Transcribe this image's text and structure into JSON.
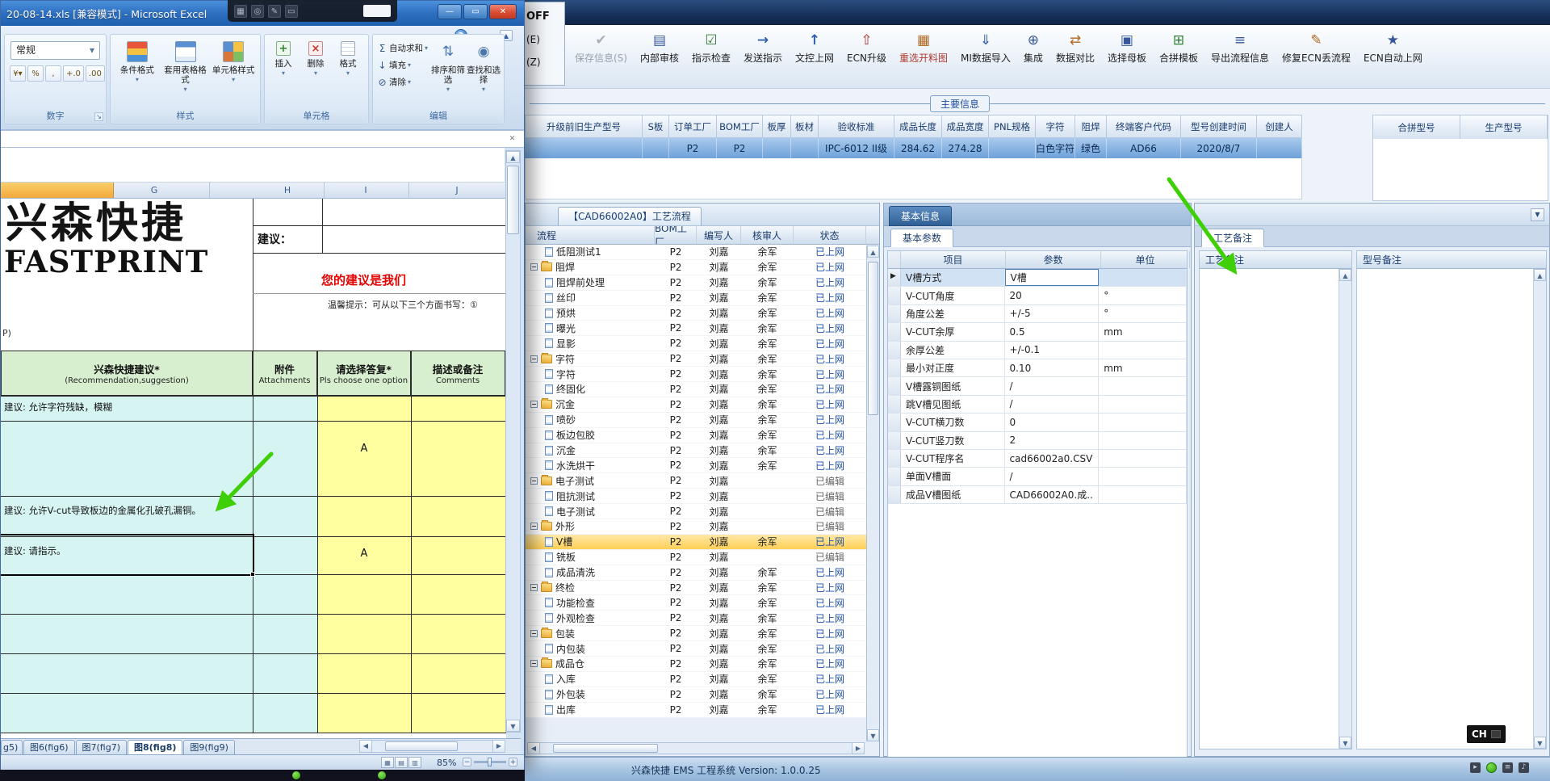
{
  "ems": {
    "partial_menu": [
      "OFF",
      "(E)",
      "(Z)"
    ],
    "toolbar": {
      "buttons": [
        {
          "label": "保存信息(S)",
          "icon": "save-icon",
          "glyph": "✔",
          "disabled": true
        },
        {
          "label": "内部审核",
          "icon": "internal-audit-icon",
          "glyph": "▤"
        },
        {
          "label": "指示检查",
          "icon": "instruction-check-icon",
          "glyph": "☑"
        },
        {
          "label": "发送指示",
          "icon": "send-instruction-icon",
          "glyph": "→"
        },
        {
          "label": "文控上网",
          "icon": "doc-upload-icon",
          "glyph": "↑"
        },
        {
          "label": "ECN升级",
          "icon": "ecn-upgrade-icon",
          "glyph": "⇧"
        },
        {
          "label": "重选开料图",
          "icon": "reselect-cutting-icon",
          "glyph": "▦",
          "accent": true
        },
        {
          "label": "MI数据导入",
          "icon": "mi-import-icon",
          "glyph": "⇓"
        },
        {
          "label": "集成",
          "icon": "integrate-icon",
          "glyph": "⊕"
        },
        {
          "label": "数据对比",
          "icon": "data-compare-icon",
          "glyph": "⇄"
        },
        {
          "label": "选择母板",
          "icon": "select-board-icon",
          "glyph": "▣"
        },
        {
          "label": "合拼模板",
          "icon": "merge-template-icon",
          "glyph": "⊞"
        },
        {
          "label": "导出流程信息",
          "icon": "export-flow-icon",
          "glyph": "≡"
        },
        {
          "label": "修复ECN丢流程",
          "icon": "repair-ecn-icon",
          "glyph": "✎"
        },
        {
          "label": "ECN自动上网",
          "icon": "ecn-auto-upload-icon",
          "glyph": "★"
        }
      ]
    },
    "main_info": {
      "legend": "主要信息",
      "columns": [
        "升级前旧生产型号",
        "S板",
        "订单工厂",
        "BOM工厂",
        "板厚",
        "板材",
        "验收标准",
        "成品长度",
        "成品宽度",
        "PNL规格",
        "字符",
        "阻焊",
        "终端客户代码",
        "型号创建时间",
        "创建人"
      ],
      "values": [
        "",
        "",
        "P2",
        "P2",
        "",
        "",
        "IPC-6012 II级",
        "284.62",
        "274.28",
        "",
        "白色字符",
        "绿色",
        "AD66",
        "2020/8/7",
        ""
      ],
      "right_columns": [
        "合拼型号",
        "生产型号"
      ]
    },
    "workflow": {
      "title": "【CAD66002A0】工艺流程",
      "columns": [
        "流程",
        "BOM工厂",
        "编写人",
        "核审人",
        "状态"
      ],
      "rows": [
        {
          "name": "低阻测试1",
          "level": 1,
          "type": "leaf",
          "bom": "P2",
          "writer": "刘嘉",
          "reviewer": "余军",
          "status": "已上网"
        },
        {
          "name": "阻焊",
          "level": 0,
          "type": "folder",
          "bom": "P2",
          "writer": "刘嘉",
          "reviewer": "余军",
          "status": "已上网"
        },
        {
          "name": "阻焊前处理",
          "level": 1,
          "type": "leaf",
          "bom": "P2",
          "writer": "刘嘉",
          "reviewer": "余军",
          "status": "已上网"
        },
        {
          "name": "丝印",
          "level": 1,
          "type": "leaf",
          "bom": "P2",
          "writer": "刘嘉",
          "reviewer": "余军",
          "status": "已上网"
        },
        {
          "name": "预烘",
          "level": 1,
          "type": "leaf",
          "bom": "P2",
          "writer": "刘嘉",
          "reviewer": "余军",
          "status": "已上网"
        },
        {
          "name": "曝光",
          "level": 1,
          "type": "leaf",
          "bom": "P2",
          "writer": "刘嘉",
          "reviewer": "余军",
          "status": "已上网"
        },
        {
          "name": "显影",
          "level": 1,
          "type": "leaf",
          "bom": "P2",
          "writer": "刘嘉",
          "reviewer": "余军",
          "status": "已上网"
        },
        {
          "name": "字符",
          "level": 0,
          "type": "folder",
          "bom": "P2",
          "writer": "刘嘉",
          "reviewer": "余军",
          "status": "已上网"
        },
        {
          "name": "字符",
          "level": 1,
          "type": "leaf",
          "bom": "P2",
          "writer": "刘嘉",
          "reviewer": "余军",
          "status": "已上网"
        },
        {
          "name": "终固化",
          "level": 1,
          "type": "leaf",
          "bom": "P2",
          "writer": "刘嘉",
          "reviewer": "余军",
          "status": "已上网"
        },
        {
          "name": "沉金",
          "level": 0,
          "type": "folder",
          "bom": "P2",
          "writer": "刘嘉",
          "reviewer": "余军",
          "status": "已上网"
        },
        {
          "name": "喷砂",
          "level": 1,
          "type": "leaf",
          "bom": "P2",
          "writer": "刘嘉",
          "reviewer": "余军",
          "status": "已上网"
        },
        {
          "name": "板边包胶",
          "level": 1,
          "type": "leaf",
          "bom": "P2",
          "writer": "刘嘉",
          "reviewer": "余军",
          "status": "已上网"
        },
        {
          "name": "沉金",
          "level": 1,
          "type": "leaf",
          "bom": "P2",
          "writer": "刘嘉",
          "reviewer": "余军",
          "status": "已上网"
        },
        {
          "name": "水洗烘干",
          "level": 1,
          "type": "leaf",
          "bom": "P2",
          "writer": "刘嘉",
          "reviewer": "余军",
          "status": "已上网"
        },
        {
          "name": "电子测试",
          "level": 0,
          "type": "folder",
          "bom": "P2",
          "writer": "刘嘉",
          "reviewer": "",
          "status": "已编辑"
        },
        {
          "name": "阻抗测试",
          "level": 1,
          "type": "leaf",
          "bom": "P2",
          "writer": "刘嘉",
          "reviewer": "",
          "status": "已编辑"
        },
        {
          "name": "电子测试",
          "level": 1,
          "type": "leaf",
          "bom": "P2",
          "writer": "刘嘉",
          "reviewer": "",
          "status": "已编辑"
        },
        {
          "name": "外形",
          "level": 0,
          "type": "folder",
          "bom": "P2",
          "writer": "刘嘉",
          "reviewer": "",
          "status": "已编辑"
        },
        {
          "name": "V槽",
          "level": 1,
          "type": "leaf",
          "bom": "P2",
          "writer": "刘嘉",
          "reviewer": "余军",
          "status": "已上网",
          "selected": true
        },
        {
          "name": "铣板",
          "level": 1,
          "type": "leaf",
          "bom": "P2",
          "writer": "刘嘉",
          "reviewer": "",
          "status": "已编辑"
        },
        {
          "name": "成品清洗",
          "level": 1,
          "type": "leaf",
          "bom": "P2",
          "writer": "刘嘉",
          "reviewer": "余军",
          "status": "已上网"
        },
        {
          "name": "终检",
          "level": 0,
          "type": "folder",
          "bom": "P2",
          "writer": "刘嘉",
          "reviewer": "余军",
          "status": "已上网"
        },
        {
          "name": "功能检查",
          "level": 1,
          "type": "leaf",
          "bom": "P2",
          "writer": "刘嘉",
          "reviewer": "余军",
          "status": "已上网"
        },
        {
          "name": "外观检查",
          "level": 1,
          "type": "leaf",
          "bom": "P2",
          "writer": "刘嘉",
          "reviewer": "余军",
          "status": "已上网"
        },
        {
          "name": "包装",
          "level": 0,
          "type": "folder",
          "bom": "P2",
          "writer": "刘嘉",
          "reviewer": "余军",
          "status": "已上网"
        },
        {
          "name": "内包装",
          "level": 1,
          "type": "leaf",
          "bom": "P2",
          "writer": "刘嘉",
          "reviewer": "余军",
          "status": "已上网"
        },
        {
          "name": "成品仓",
          "level": 0,
          "type": "folder",
          "bom": "P2",
          "writer": "刘嘉",
          "reviewer": "余军",
          "status": "已上网"
        },
        {
          "name": "入库",
          "level": 1,
          "type": "leaf",
          "bom": "P2",
          "writer": "刘嘉",
          "reviewer": "余军",
          "status": "已上网"
        },
        {
          "name": "外包装",
          "level": 1,
          "type": "leaf",
          "bom": "P2",
          "writer": "刘嘉",
          "reviewer": "余军",
          "status": "已上网"
        },
        {
          "name": "出库",
          "level": 1,
          "type": "leaf",
          "bom": "P2",
          "writer": "刘嘉",
          "reviewer": "余军",
          "status": "已上网"
        }
      ]
    },
    "basic_info": {
      "tab": "基本信息",
      "subtab": "基本参数",
      "columns": [
        "项目",
        "参数",
        "单位"
      ],
      "rows": [
        {
          "item": "V槽方式",
          "param": "V槽",
          "unit": "",
          "selected": true
        },
        {
          "item": "V-CUT角度",
          "param": "20",
          "unit": "°"
        },
        {
          "item": "角度公差",
          "param": "+/-5",
          "unit": "°"
        },
        {
          "item": "V-CUT余厚",
          "param": "0.5",
          "unit": "mm"
        },
        {
          "item": "余厚公差",
          "param": "+/-0.1",
          "unit": ""
        },
        {
          "item": "最小对正度",
          "param": "0.10",
          "unit": "mm"
        },
        {
          "item": "V槽露铜图纸",
          "param": "/",
          "unit": ""
        },
        {
          "item": "跳V槽见图纸",
          "param": "/",
          "unit": ""
        },
        {
          "item": "V-CUT横刀数",
          "param": "0",
          "unit": ""
        },
        {
          "item": "V-CUT竖刀数",
          "param": "2",
          "unit": ""
        },
        {
          "item": "V-CUT程序名",
          "param": "cad66002a0.CSV",
          "unit": ""
        },
        {
          "item": "单面V槽面",
          "param": "/",
          "unit": ""
        },
        {
          "item": "成品V槽图纸",
          "param": "CAD66002A0.成..",
          "unit": ""
        }
      ]
    },
    "remarks": {
      "tab": "工艺备注",
      "left_title": "工艺备注",
      "right_title": "型号备注"
    },
    "status_bar": {
      "text": "兴森快捷 EMS 工程系统 Version: 1.0.0.25"
    },
    "ime": {
      "label": "CH"
    }
  },
  "excel": {
    "title": "20-08-14.xls [兼容模式] - Microsoft Excel",
    "ribbon": {
      "number_format_value": "常规",
      "group_number": "数字",
      "group_styles": "样式",
      "group_cells": "单元格",
      "group_editing": "编辑",
      "btn_conditional": "条件格式",
      "btn_table_format": "套用表格格式",
      "btn_cell_styles": "单元格样式",
      "btn_insert": "插入",
      "btn_delete": "删除",
      "btn_format": "格式",
      "btn_autosum": "自动求和",
      "btn_fill": "填充",
      "btn_clear": "清除",
      "btn_sort": "排序和筛选",
      "btn_find": "查找和选择"
    },
    "column_headers": [
      "G",
      "H",
      "I",
      "J"
    ],
    "sheet": {
      "logo_cn": "兴森快捷",
      "logo_en": "FASTPRINT",
      "suggest_label": "建议：",
      "red_text": "您的建议是我们",
      "tip_text": "温馨提示：可从以下三个方面书写：①",
      "left_fragment": "P)",
      "header_cells": [
        {
          "line1": "兴森快捷建议*",
          "line2": "(Recommendation,suggestion)"
        },
        {
          "line1": "附件",
          "line2": "Attachments"
        },
        {
          "line1": "请选择答复*",
          "line2": "Pls choose one option"
        },
        {
          "line1": "描述或备注",
          "line2": "Comments"
        }
      ],
      "suggestion_1": "建议: 允许字符残缺，模糊",
      "suggestion_2": "建议: 允许V-cut导致板边的金属化孔破孔漏铜。",
      "suggestion_3": "建议: 请指示。",
      "answer_a1": "A",
      "answer_a2": "A"
    },
    "sheet_tabs": [
      {
        "label": "g5)"
      },
      {
        "label": "图6(fig6)"
      },
      {
        "label": "图7(fig7)"
      },
      {
        "label": "图8(fig8)",
        "active": true
      },
      {
        "label": "图9(fig9)"
      }
    ],
    "status": {
      "zoom": "85%"
    }
  }
}
